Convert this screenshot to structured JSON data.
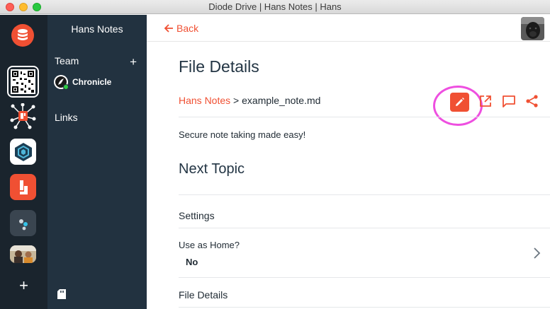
{
  "window": {
    "title": "Diode Drive | Hans Notes | Hans"
  },
  "sidebar": {
    "title": "Hans Notes",
    "team_label": "Team",
    "team_add": "+",
    "chronicle_label": "Chronicle",
    "links_label": "Links"
  },
  "rail": {
    "add": "+"
  },
  "header": {
    "back_label": "Back"
  },
  "main": {
    "title": "File Details",
    "breadcrumb_root": "Hans Notes",
    "breadcrumb_sep": " > ",
    "breadcrumb_file": "example_note.md",
    "description": "Secure note taking made easy!",
    "next_topic": "Next Topic",
    "settings": "Settings",
    "use_home_label": "Use as Home?",
    "use_home_value": "No",
    "file_details": "File Details"
  },
  "colors": {
    "accent": "#f05033",
    "rail_bg": "#1a242d",
    "sidebar_bg": "#223240",
    "highlight": "#ee4fe0"
  }
}
